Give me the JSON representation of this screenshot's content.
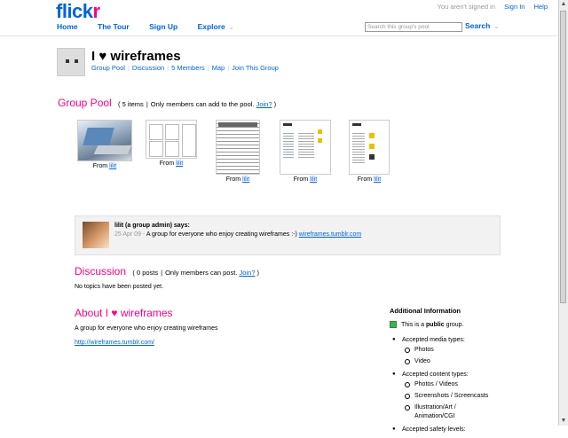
{
  "header": {
    "logo_flick": "flick",
    "logo_r": "r",
    "not_signed_in": "You aren't signed in",
    "sign_in": "Sign In",
    "help": "Help",
    "nav": [
      "Home",
      "The Tour",
      "Sign Up",
      "Explore"
    ],
    "explore_chevron": "⌄",
    "search_placeholder": "Search this group's pool",
    "search_button": "Search"
  },
  "group": {
    "title": "I ♥ wireframes",
    "links": [
      "Group Pool",
      "Discussion",
      "5 Members",
      "Map",
      "Join This Group"
    ]
  },
  "pool": {
    "title": "Group Pool",
    "meta_count": "( 5 items",
    "meta_rule": "Only members can add to the pool.",
    "join": "Join?",
    "close": ")",
    "items": [
      {
        "from": "From",
        "user": "lilit"
      },
      {
        "from": "From",
        "user": "lilit"
      },
      {
        "from": "From",
        "user": "lilit"
      },
      {
        "from": "From",
        "user": "lilit"
      },
      {
        "from": "From",
        "user": "lilit"
      }
    ]
  },
  "admin": {
    "name": "lilit (a group admin) says:",
    "date": "25 Apr 09 -",
    "message": "A group for everyone who enjoy creating wireframes :-)",
    "link": "wireframes.tumblr.com"
  },
  "discussion": {
    "title": "Discussion",
    "meta_count": "( 0 posts",
    "meta_rule": "Only members can post.",
    "join": "Join?",
    "close": ")",
    "empty": "No topics have been posted yet."
  },
  "about": {
    "title": "About I ♥ wireframes",
    "desc": "A group for everyone who enjoy creating wireframes",
    "link": "http://wireframes.tumblr.com/"
  },
  "additional": {
    "heading": "Additional Information",
    "public_pre": "This is a",
    "public_bold": "public",
    "public_post": "group.",
    "media_label": "Accepted media types:",
    "media": [
      "Photos",
      "Video"
    ],
    "content_label": "Accepted content types:",
    "content": [
      "Photos / Videos",
      "Screenshots / Screencasts",
      "Illustration/Art / Animation/CGI"
    ],
    "safety_label": "Accepted safety levels:"
  },
  "colors": {
    "brand_blue": "#0063dc",
    "brand_pink": "#ff0084",
    "public_green": "#3ab54a"
  }
}
